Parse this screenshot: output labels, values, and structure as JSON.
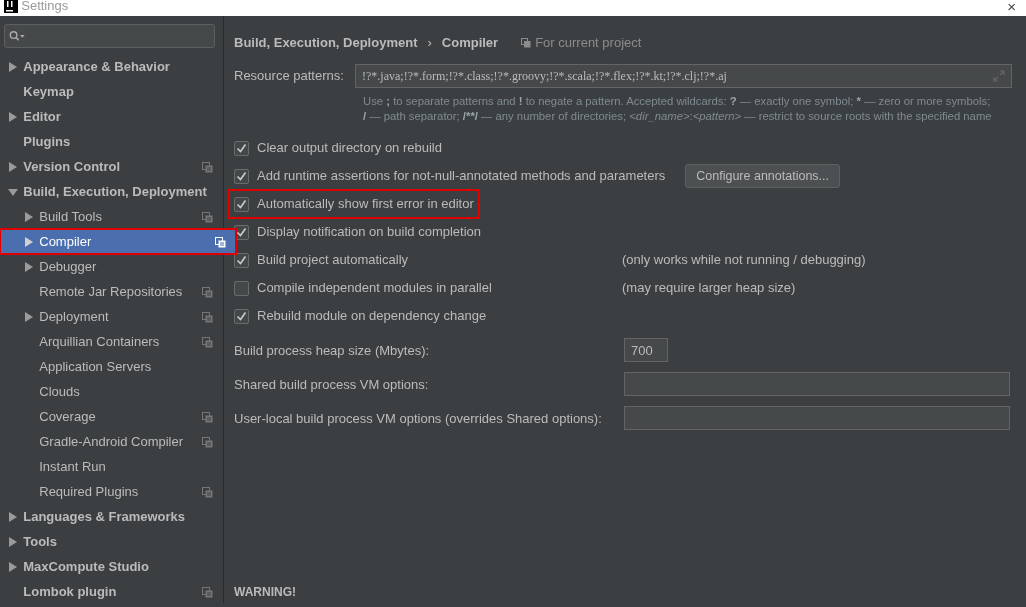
{
  "window": {
    "title": "Settings",
    "close": "×"
  },
  "sidebar": {
    "items": [
      {
        "label": "Appearance & Behavior",
        "expandable": true,
        "expanded": false,
        "project_scope": false,
        "selected": false,
        "highlighted": false
      },
      {
        "label": "Keymap",
        "expandable": false,
        "project_scope": false,
        "selected": false,
        "highlighted": false
      },
      {
        "label": "Editor",
        "expandable": true,
        "expanded": false,
        "project_scope": false,
        "selected": false,
        "highlighted": false
      },
      {
        "label": "Plugins",
        "expandable": false,
        "project_scope": false,
        "selected": false,
        "highlighted": false
      },
      {
        "label": "Version Control",
        "expandable": true,
        "expanded": false,
        "project_scope": true,
        "selected": false,
        "highlighted": false
      },
      {
        "label": "Build, Execution, Deployment",
        "expandable": true,
        "expanded": true,
        "project_scope": false,
        "selected": false,
        "highlighted": false,
        "children": [
          {
            "label": "Build Tools",
            "expandable": true,
            "expanded": false,
            "project_scope": true,
            "selected": false,
            "highlighted": false
          },
          {
            "label": "Compiler",
            "expandable": true,
            "expanded": false,
            "project_scope": true,
            "selected": true,
            "highlighted": true
          },
          {
            "label": "Debugger",
            "expandable": true,
            "expanded": false,
            "project_scope": false,
            "selected": false,
            "highlighted": false
          },
          {
            "label": "Remote Jar Repositories",
            "expandable": false,
            "project_scope": true,
            "selected": false,
            "highlighted": false
          },
          {
            "label": "Deployment",
            "expandable": true,
            "expanded": false,
            "project_scope": true,
            "selected": false,
            "highlighted": false
          },
          {
            "label": "Arquillian Containers",
            "expandable": false,
            "project_scope": true,
            "selected": false,
            "highlighted": false
          },
          {
            "label": "Application Servers",
            "expandable": false,
            "project_scope": false,
            "selected": false,
            "highlighted": false
          },
          {
            "label": "Clouds",
            "expandable": false,
            "project_scope": false,
            "selected": false,
            "highlighted": false
          },
          {
            "label": "Coverage",
            "expandable": false,
            "project_scope": true,
            "selected": false,
            "highlighted": false
          },
          {
            "label": "Gradle-Android Compiler",
            "expandable": false,
            "project_scope": true,
            "selected": false,
            "highlighted": false
          },
          {
            "label": "Instant Run",
            "expandable": false,
            "project_scope": false,
            "selected": false,
            "highlighted": false
          },
          {
            "label": "Required Plugins",
            "expandable": false,
            "project_scope": true,
            "selected": false,
            "highlighted": false
          }
        ]
      },
      {
        "label": "Languages & Frameworks",
        "expandable": true,
        "expanded": false,
        "project_scope": false,
        "selected": false,
        "highlighted": false
      },
      {
        "label": "Tools",
        "expandable": true,
        "expanded": false,
        "project_scope": false,
        "selected": false,
        "highlighted": false
      },
      {
        "label": "MaxCompute Studio",
        "expandable": true,
        "expanded": false,
        "project_scope": false,
        "selected": false,
        "highlighted": false
      },
      {
        "label": "Lombok plugin",
        "expandable": false,
        "project_scope": true,
        "selected": false,
        "highlighted": false
      }
    ]
  },
  "breadcrumb": {
    "parent": "Build, Execution, Deployment",
    "separator": "›",
    "current": "Compiler",
    "scope": "For current project"
  },
  "resource_patterns": {
    "label": "Resource patterns:",
    "value": "!?*.java;!?*.form;!?*.class;!?*.groovy;!?*.scala;!?*.flex;!?*.kt;!?*.clj;!?*.aj",
    "hint": [
      {
        "kind": "plain",
        "text": "Use "
      },
      {
        "kind": "bold",
        "text": ";"
      },
      {
        "kind": "plain",
        "text": " to separate patterns and "
      },
      {
        "kind": "bold",
        "text": "!"
      },
      {
        "kind": "plain",
        "text": " to negate a pattern. Accepted wildcards: "
      },
      {
        "kind": "bold",
        "text": "?"
      },
      {
        "kind": "plain",
        "text": " — exactly one symbol; "
      },
      {
        "kind": "bold",
        "text": "*"
      },
      {
        "kind": "plain",
        "text": " — zero or more symbols; "
      },
      {
        "kind": "bold",
        "text": "/"
      },
      {
        "kind": "plain",
        "text": " — path separator; "
      },
      {
        "kind": "bold",
        "text": "/**/"
      },
      {
        "kind": "plain",
        "text": " — any number of directories; "
      },
      {
        "kind": "italic",
        "text": "<dir_name>"
      },
      {
        "kind": "plain",
        "text": ":"
      },
      {
        "kind": "italic",
        "text": "<pattern>"
      },
      {
        "kind": "plain",
        "text": " — restrict to source roots with the specified name"
      }
    ]
  },
  "options": [
    {
      "label": "Clear output directory on rebuild",
      "checked": true,
      "highlighted": false
    },
    {
      "label": "Add runtime assertions for not-null-annotated methods and parameters",
      "checked": true,
      "highlighted": false,
      "button": "Configure annotations..."
    },
    {
      "label": "Automatically show first error in editor",
      "checked": true,
      "highlighted": true
    },
    {
      "label": "Display notification on build completion",
      "checked": true,
      "highlighted": false
    },
    {
      "label": "Build project automatically",
      "checked": true,
      "highlighted": false,
      "note": "(only works while not running / debugging)"
    },
    {
      "label": "Compile independent modules in parallel",
      "checked": false,
      "highlighted": false,
      "note": "(may require larger heap size)"
    },
    {
      "label": "Rebuild module on dependency change",
      "checked": true,
      "highlighted": false
    }
  ],
  "fields": [
    {
      "label": "Build process heap size (Mbytes):",
      "kind": "number",
      "value": "700"
    },
    {
      "label": "Shared build process VM options:",
      "kind": "text"
    },
    {
      "label": "User-local build process VM options (overrides Shared options):",
      "kind": "text"
    }
  ],
  "warning": "WARNING!"
}
